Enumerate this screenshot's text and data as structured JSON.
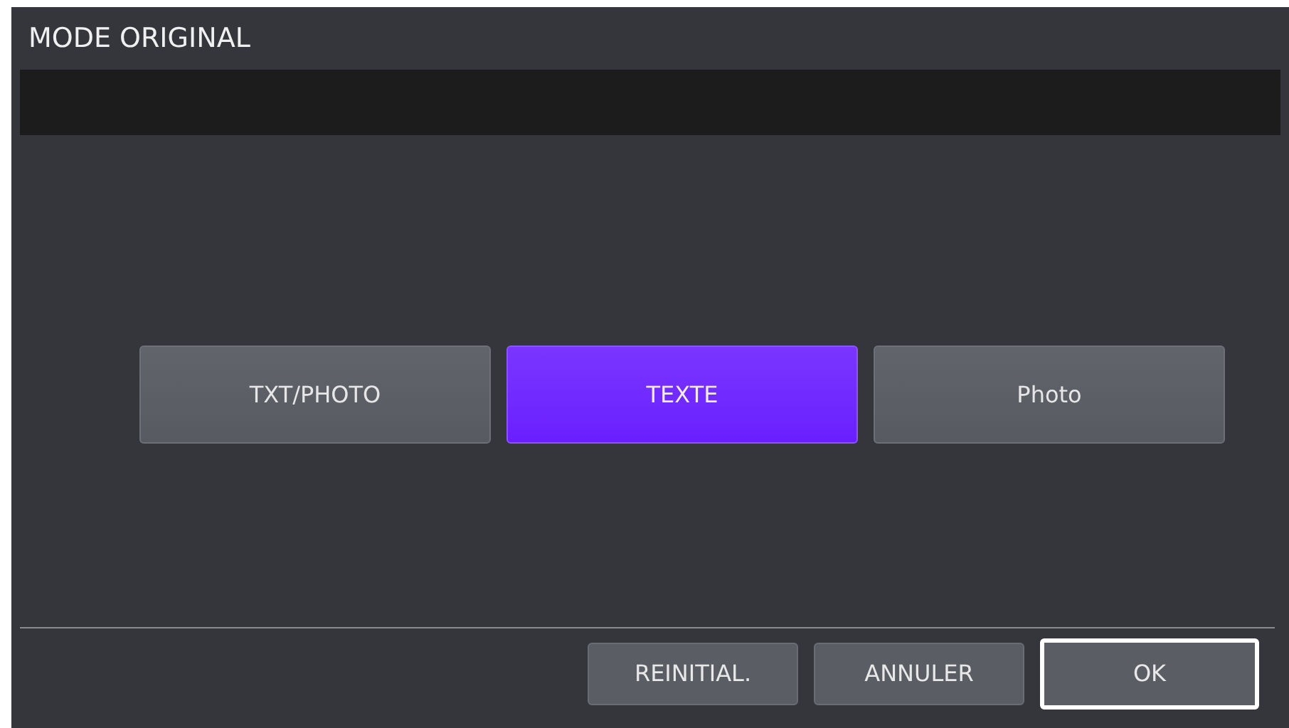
{
  "window": {
    "title": "MODE ORIGINAL"
  },
  "options": [
    {
      "label": "TXT/PHOTO",
      "selected": false
    },
    {
      "label": "TEXTE",
      "selected": true
    },
    {
      "label": "Photo",
      "selected": false
    }
  ],
  "buttons": [
    {
      "label": "REINITIAL.",
      "focused": false
    },
    {
      "label": "ANNULER",
      "focused": false
    },
    {
      "label": "OK",
      "focused": true
    }
  ]
}
